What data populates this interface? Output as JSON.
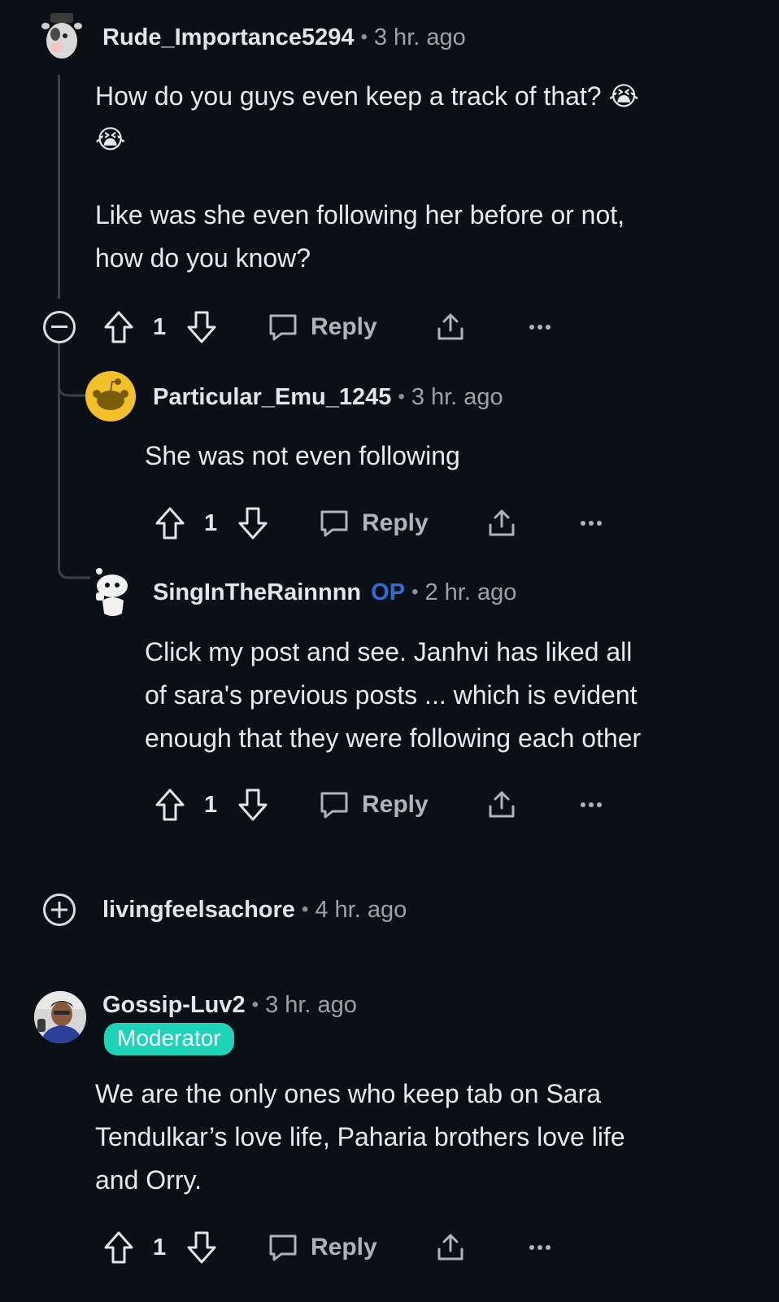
{
  "comments": [
    {
      "username": "Rude_Importance5294",
      "time": "3 hr. ago",
      "body": [
        "How do you guys even keep a track of that? 😭",
        "😭",
        "",
        "Like was she even following her before or not,",
        "how do you know?"
      ],
      "upvotes": "1",
      "reply_label": "Reply",
      "avatar_icon": "snoo-cow-avatar-icon",
      "replies": [
        {
          "username": "Particular_Emu_1245",
          "time": "3 hr. ago",
          "body": [
            "She was not even following"
          ],
          "upvotes": "1",
          "reply_label": "Reply",
          "avatar_icon": "default-snoo-yellow-avatar-icon"
        },
        {
          "username": "SingInTheRainnnn",
          "op_label": "OP",
          "time": "2 hr. ago",
          "body": [
            "Click my post and see. Janhvi has liked all",
            "of sara's previous posts ... which is evident",
            "enough that they were following each other"
          ],
          "upvotes": "1",
          "reply_label": "Reply",
          "avatar_icon": "snoo-white-avatar-icon"
        }
      ]
    },
    {
      "username": "livingfeelsachore",
      "time": "4 hr. ago",
      "collapsed": true
    },
    {
      "username": "Gossip-Luv2",
      "time": "3 hr. ago",
      "flair": "Moderator",
      "body": [
        "We are the only ones who keep tab on Sara",
        "Tendulkar’s love life, Paharia brothers love life",
        "and Orry."
      ],
      "upvotes": "1",
      "reply_label": "Reply",
      "avatar_icon": "photo-avatar-icon"
    }
  ],
  "colors": {
    "background": "#0b1016",
    "op": "#2e6fd6",
    "moderator_badge": "#1ed3b7",
    "avatar_yellow": "#f1c02b"
  }
}
